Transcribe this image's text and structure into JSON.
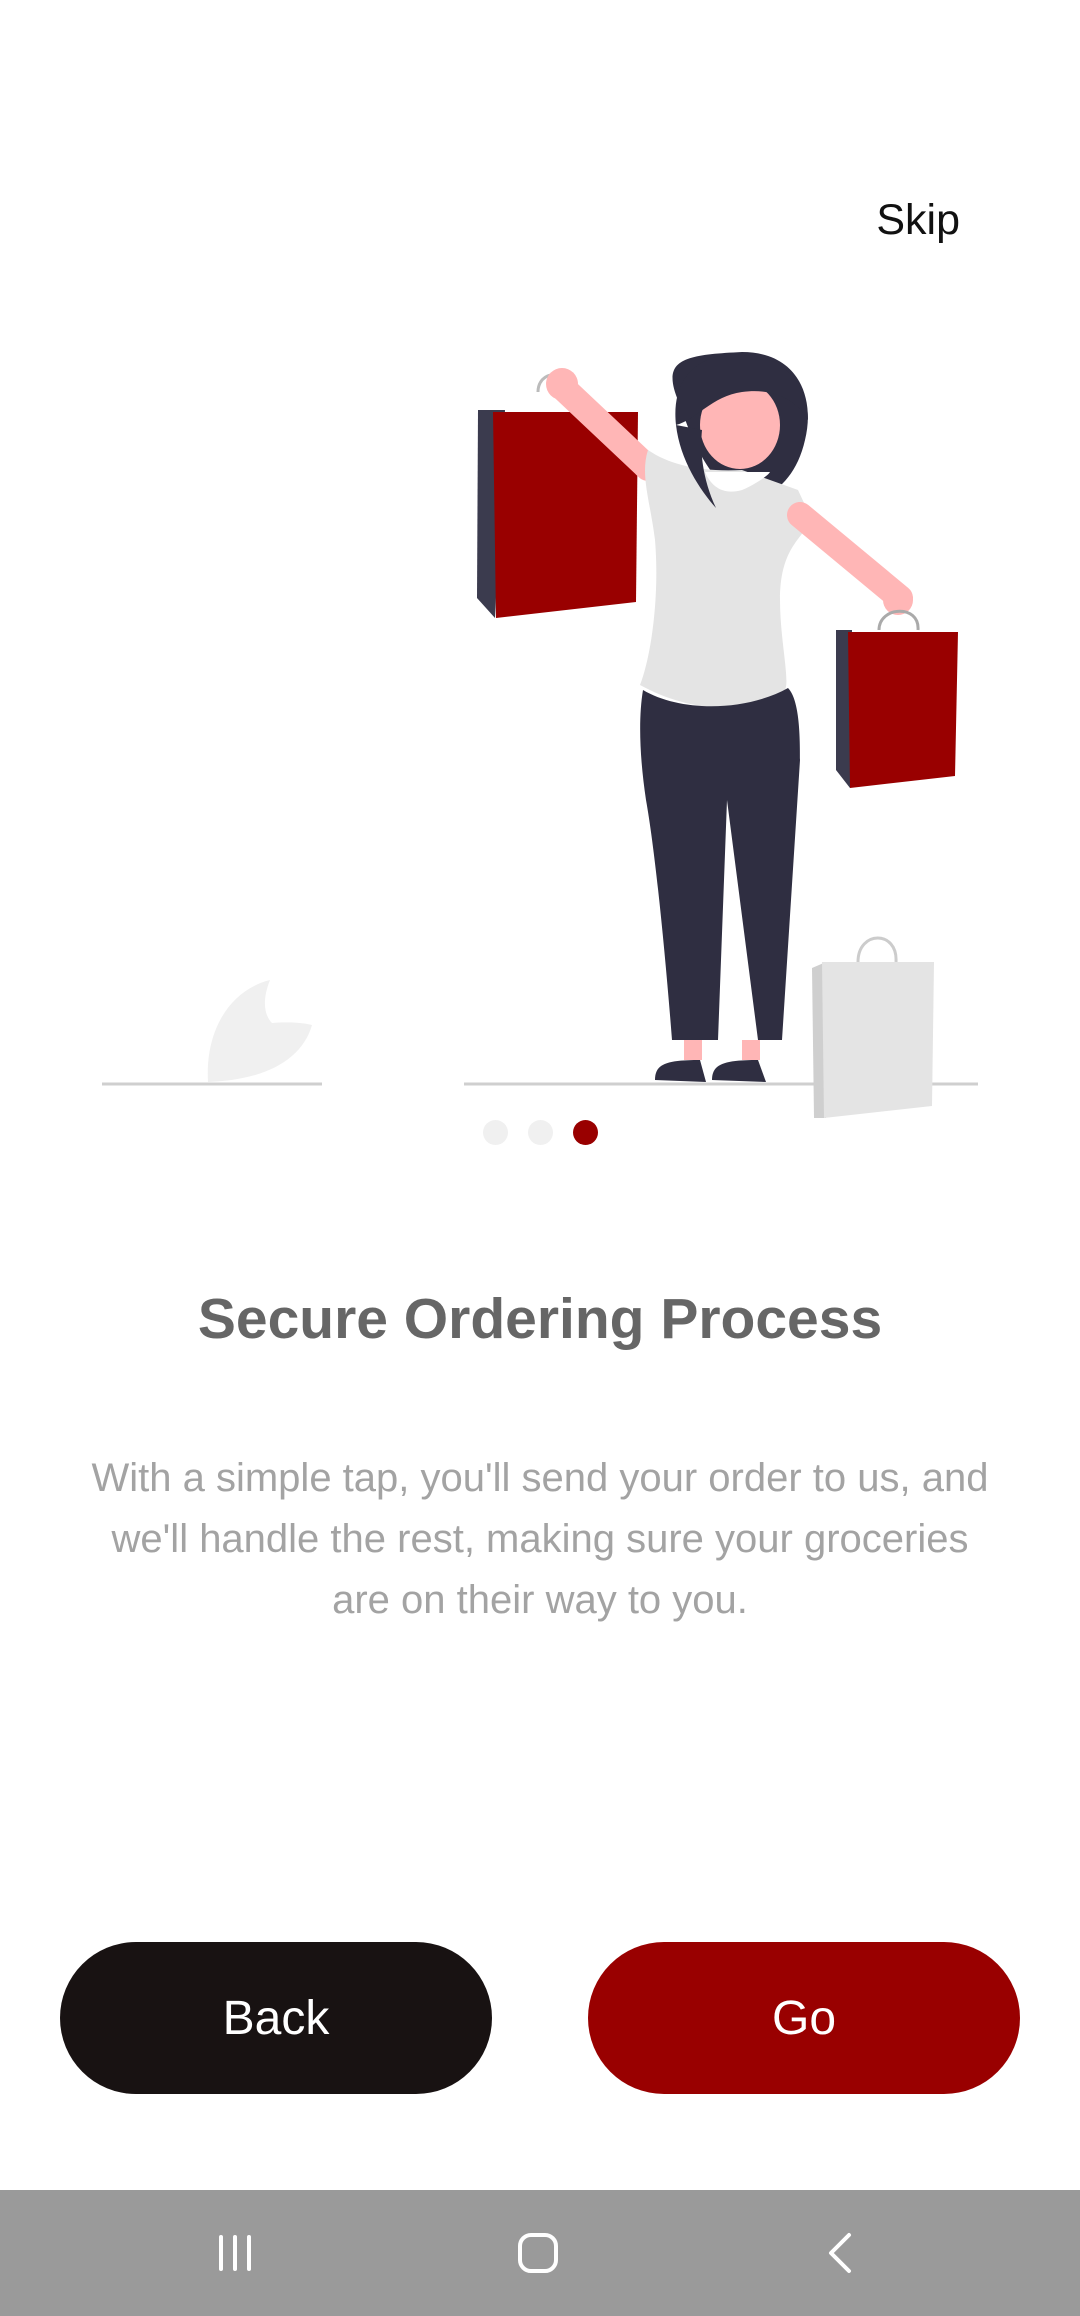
{
  "header": {
    "skip_label": "Skip"
  },
  "onboarding": {
    "illustration_icon": "shopping-woman-illustration",
    "pager": {
      "total": 3,
      "active_index": 2
    },
    "title": "Secure Ordering Process",
    "description": "With a simple tap, you'll send your order to us, and we'll handle the rest, making sure your groceries are on their way to you."
  },
  "actions": {
    "back_label": "Back",
    "go_label": "Go"
  },
  "navbar": {
    "recents_icon": "recents-icon",
    "home_icon": "home-icon",
    "back_icon": "back-icon"
  },
  "colors": {
    "accent": "#990000",
    "dark_button": "#181212",
    "title_text": "#666666",
    "body_text": "#a3a3a3",
    "navbar": "#9a9a9a"
  }
}
